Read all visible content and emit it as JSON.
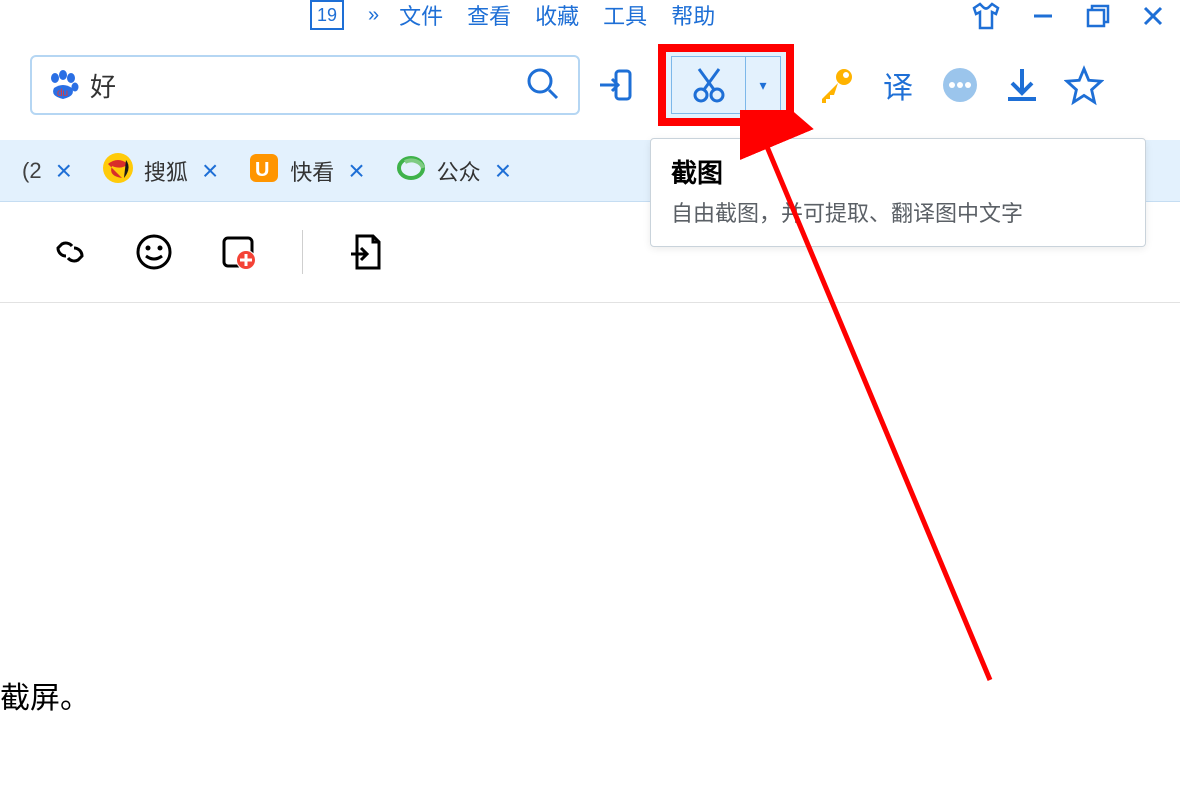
{
  "menu": {
    "calendar_day": "19",
    "items": [
      "文件",
      "查看",
      "收藏",
      "工具",
      "帮助"
    ]
  },
  "search": {
    "value": "好",
    "placeholder": ""
  },
  "tabs": [
    {
      "label_prefix": "(2",
      "label": ""
    },
    {
      "label": "搜狐"
    },
    {
      "label": "快看"
    },
    {
      "label": "公众"
    }
  ],
  "tooltip": {
    "title": "截图",
    "desc": "自由截图，并可提取、翻译图中文字"
  },
  "page": {
    "content_fragment": "截屏。"
  },
  "icons": {
    "chevrons": "»",
    "dropdown_arrow": "▾"
  }
}
